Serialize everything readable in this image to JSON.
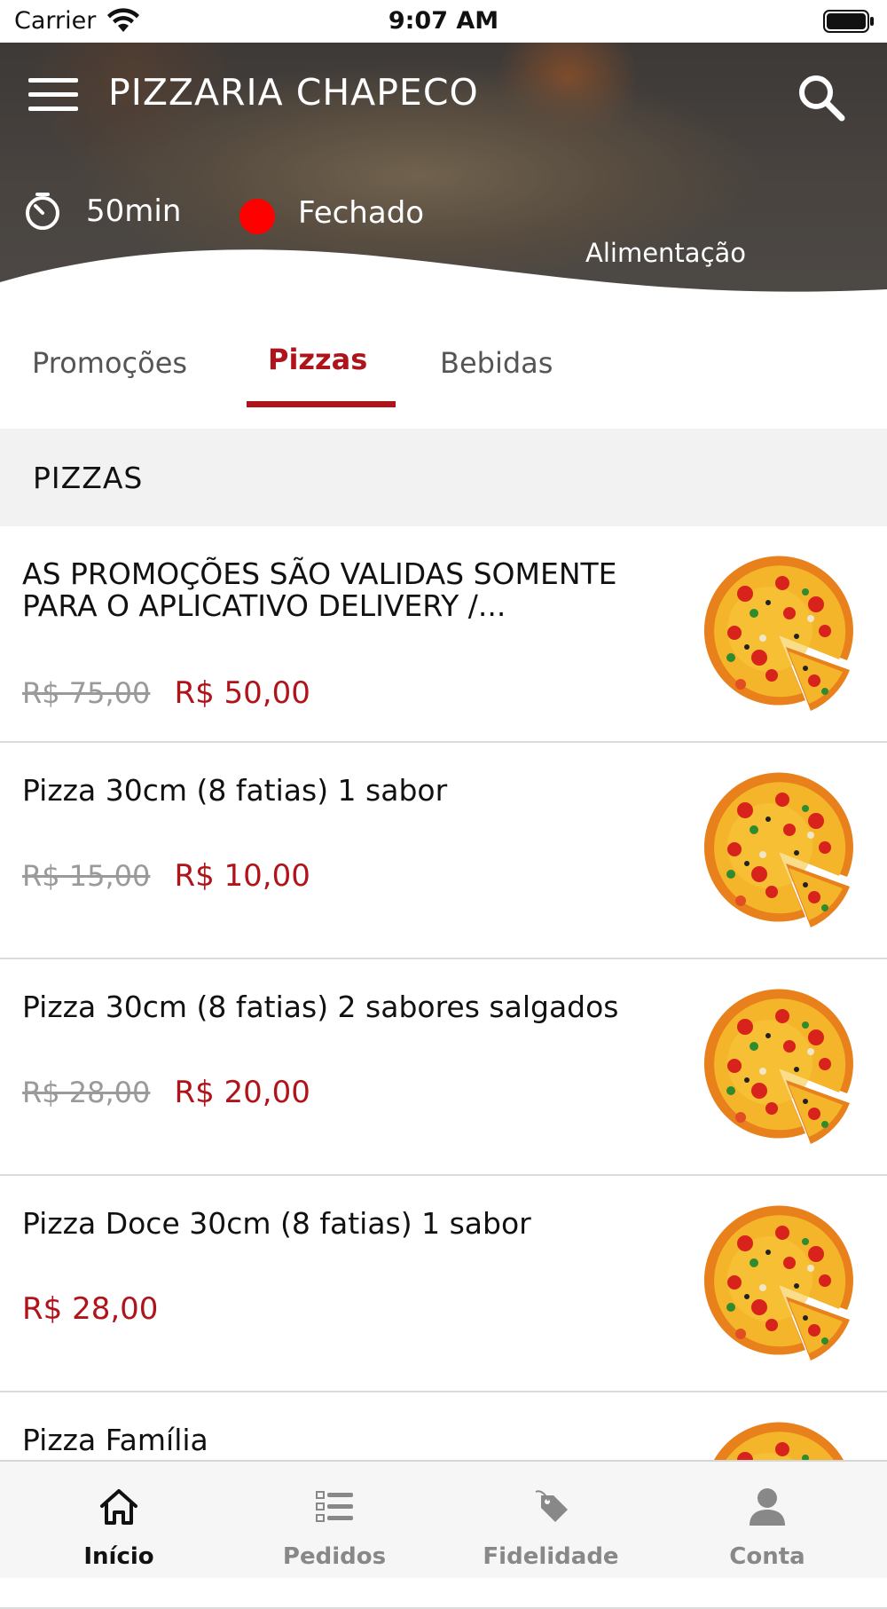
{
  "status_bar": {
    "carrier": "Carrier",
    "time": "9:07 AM"
  },
  "header": {
    "title": "PIZZARIA CHAPECO",
    "delivery_time": "50min",
    "store_status": "Fechado",
    "status_color": "#ff0000",
    "category": "Alimentação"
  },
  "tabs": [
    {
      "label": "Promoções",
      "active": false
    },
    {
      "label": "Pizzas",
      "active": true
    },
    {
      "label": "Bebidas",
      "active": false
    }
  ],
  "accent_color": "#b0141b",
  "section": {
    "title": "PIZZAS"
  },
  "products": [
    {
      "name": "AS PROMOÇÕES SÃO VALIDAS SOMENTE PARA O APLICATIVO DELIVERY /...",
      "old_price": "R$ 75,00",
      "price": "R$ 50,00",
      "image_icon": "pizza-image"
    },
    {
      "name": "Pizza 30cm (8 fatias) 1 sabor",
      "old_price": "R$ 15,00",
      "price": "R$ 10,00",
      "image_icon": "pizza-image"
    },
    {
      "name": "Pizza 30cm (8 fatias)  2 sabores salgados",
      "old_price": "R$ 28,00",
      "price": "R$ 20,00",
      "image_icon": "pizza-image"
    },
    {
      "name": "Pizza Doce 30cm (8 fatias) 1 sabor",
      "old_price": "",
      "price": "R$ 28,00",
      "image_icon": "pizza-image"
    },
    {
      "name": "Pizza Família",
      "old_price": "",
      "price": "",
      "image_icon": "pizza-image"
    }
  ],
  "tabbar": [
    {
      "label": "Início",
      "icon": "home-icon",
      "active": true
    },
    {
      "label": "Pedidos",
      "icon": "orders-list-icon",
      "active": false
    },
    {
      "label": "Fidelidade",
      "icon": "loyalty-tag-icon",
      "active": false
    },
    {
      "label": "Conta",
      "icon": "user-icon",
      "active": false
    }
  ]
}
